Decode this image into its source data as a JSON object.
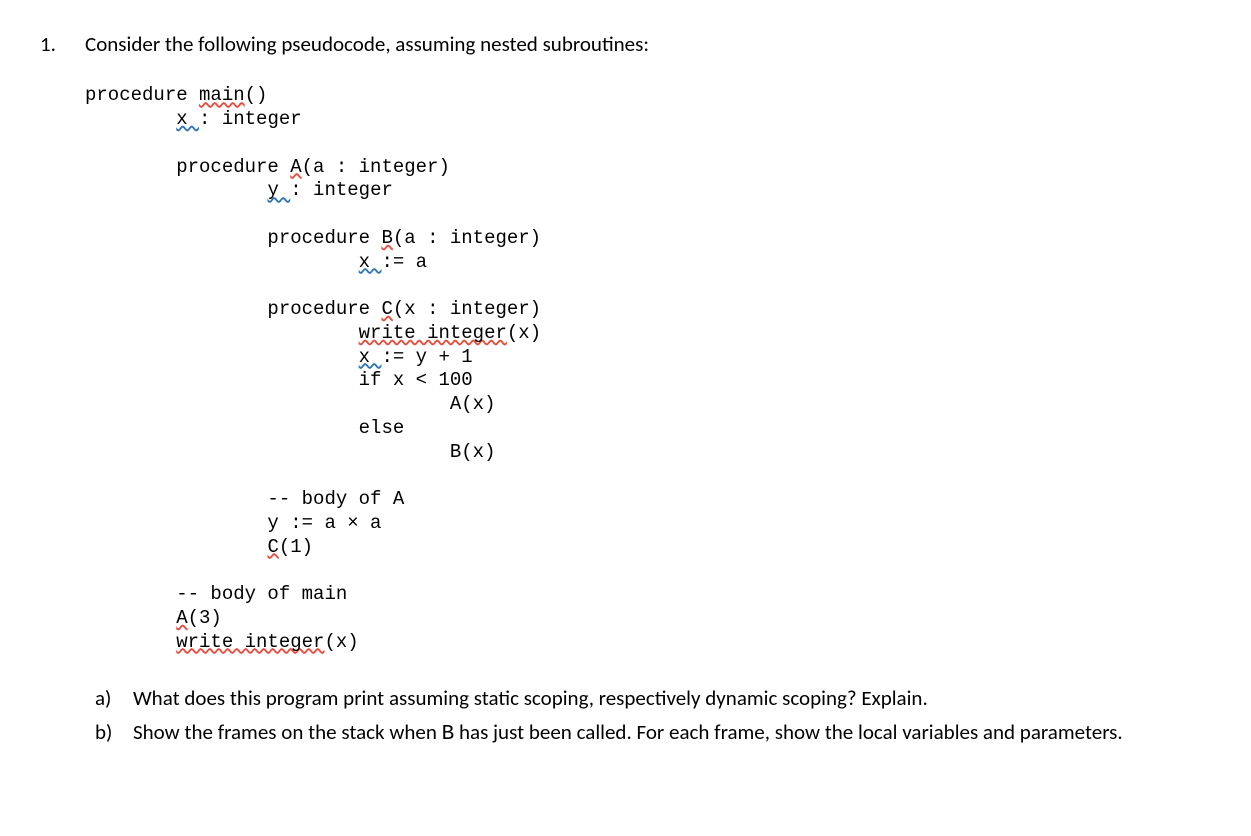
{
  "question": {
    "number": "1.",
    "text": "Consider the following pseudocode, assuming nested subroutines:"
  },
  "code": {
    "l01a": "procedure ",
    "l01b": "main",
    "l01c": "()",
    "l02a": "        ",
    "l02b": "x ",
    "l02c": ": integer",
    "l04a": "        procedure ",
    "l04b": "A",
    "l04c": "(a : integer)",
    "l05a": "                ",
    "l05b": "y ",
    "l05c": ": integer",
    "l07a": "                procedure ",
    "l07b": "B",
    "l07c": "(a : integer)",
    "l08a": "                        ",
    "l08b": "x ",
    "l08c": ":= a",
    "l10a": "                procedure ",
    "l10b": "C",
    "l10c": "(x : integer)",
    "l11a": "                        ",
    "l11b": "write integer",
    "l11c": "(x)",
    "l12a": "                        ",
    "l12b": "x ",
    "l12c": ":= y + 1",
    "l13": "                        if x < 100",
    "l14": "                                A(x)",
    "l15": "                        else",
    "l16": "                                B(x)",
    "l18": "                -- body of A",
    "l19": "                y := a × a",
    "l20a": "                ",
    "l20b": "C",
    "l20c": "(1)",
    "l22": "        -- body of main",
    "l23a": "        ",
    "l23b": "A",
    "l23c": "(3)",
    "l24a": "        ",
    "l24b": "write integer",
    "l24c": "(x)"
  },
  "subquestions": {
    "a": {
      "label": "a)",
      "text": "What does this program print assuming static scoping, respectively dynamic scoping? Explain."
    },
    "b": {
      "label": "b)",
      "text_before": "Show the frames on the stack when ",
      "mono": "B",
      "text_after": " has just been called. For each frame, show the local variables and parameters."
    }
  }
}
